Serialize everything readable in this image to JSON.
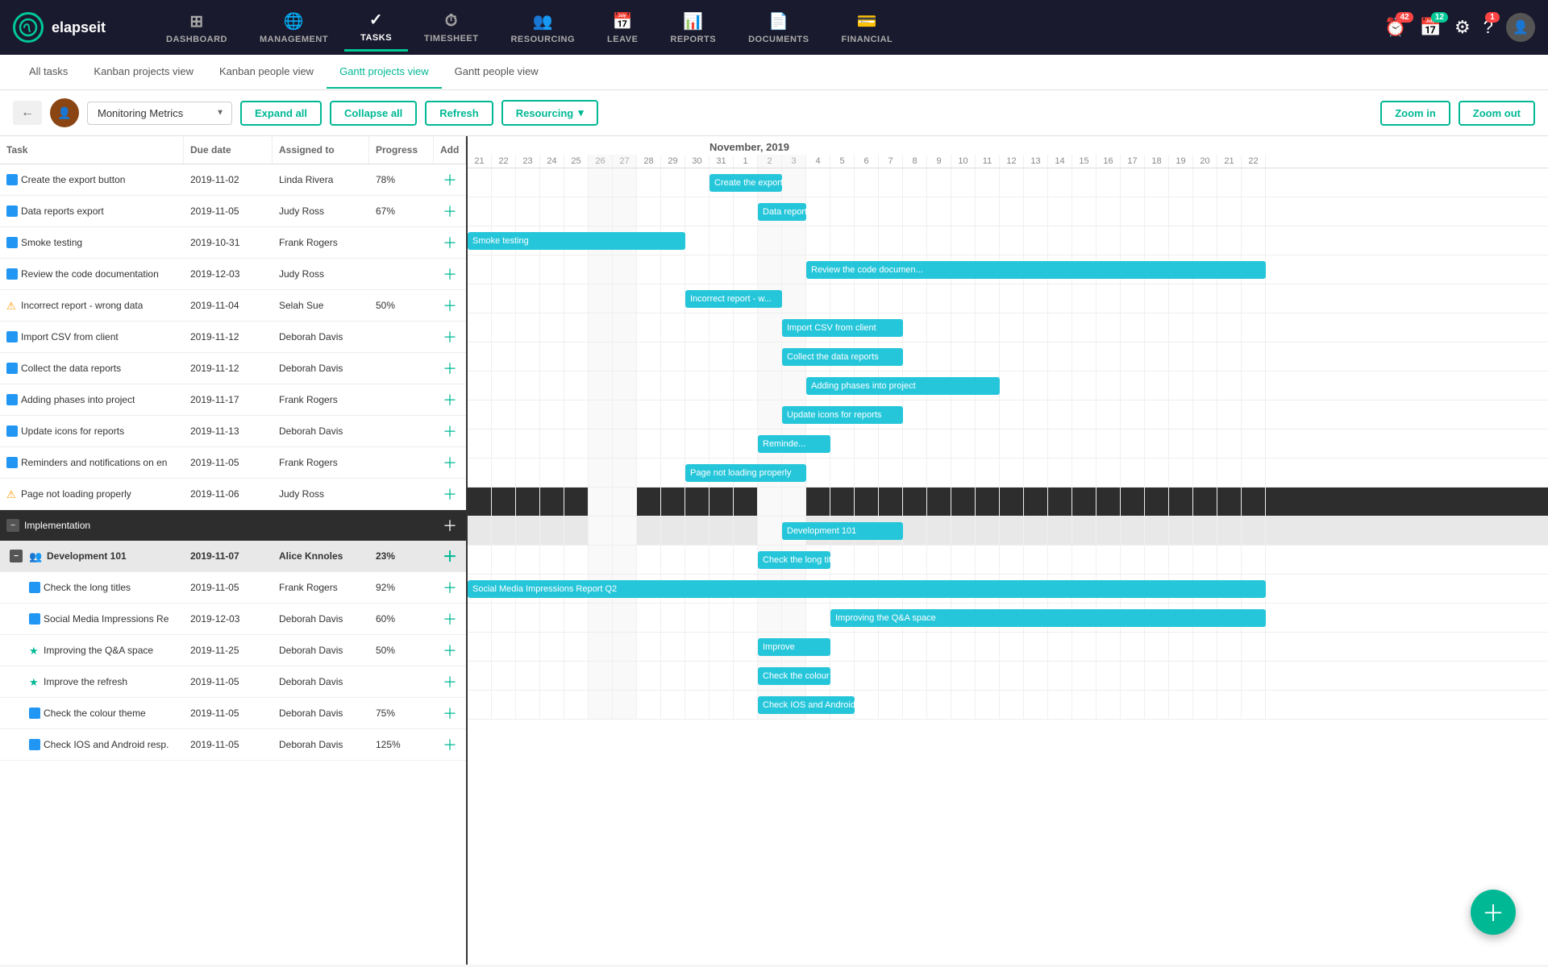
{
  "app": {
    "logo_text": "elapseit",
    "logo_icon": "©"
  },
  "nav": {
    "items": [
      {
        "id": "dashboard",
        "label": "DASHBOARD",
        "icon": "⊞"
      },
      {
        "id": "management",
        "label": "MANAGEMENT",
        "icon": "🌐"
      },
      {
        "id": "tasks",
        "label": "TASKS",
        "icon": "✓",
        "active": true
      },
      {
        "id": "timesheet",
        "label": "TIMESHEET",
        "icon": "⏱"
      },
      {
        "id": "resourcing",
        "label": "RESOURCING",
        "icon": "👥"
      },
      {
        "id": "leave",
        "label": "LEAVE",
        "icon": "📅"
      },
      {
        "id": "reports",
        "label": "REPORTS",
        "icon": "📊"
      },
      {
        "id": "documents",
        "label": "DOCUMENTS",
        "icon": "📄"
      },
      {
        "id": "financial",
        "label": "FINANCIAL",
        "icon": "💳"
      }
    ],
    "badges": {
      "alerts": "42",
      "calendar": "12"
    }
  },
  "sub_nav": {
    "items": [
      {
        "id": "all-tasks",
        "label": "All tasks"
      },
      {
        "id": "kanban-projects",
        "label": "Kanban projects view"
      },
      {
        "id": "kanban-people",
        "label": "Kanban people view"
      },
      {
        "id": "gantt-projects",
        "label": "Gantt projects view",
        "active": true
      },
      {
        "id": "gantt-people",
        "label": "Gantt people view"
      }
    ]
  },
  "toolbar": {
    "project_name": "Monitoring Metrics",
    "expand_label": "Expand all",
    "collapse_label": "Collapse all",
    "refresh_label": "Refresh",
    "resourcing_label": "Resourcing",
    "zoom_in_label": "Zoom in",
    "zoom_out_label": "Zoom out"
  },
  "table": {
    "headers": [
      "Task",
      "Due date",
      "Assigned to",
      "Progress",
      "Add"
    ],
    "tasks": [
      {
        "icon": "blue",
        "name": "Create the export button",
        "date": "2019-11-02",
        "assignee": "Linda Rivera",
        "progress": "78%",
        "indent": 0
      },
      {
        "icon": "blue",
        "name": "Data reports export",
        "date": "2019-11-05",
        "assignee": "Judy Ross",
        "progress": "67%",
        "indent": 0
      },
      {
        "icon": "blue",
        "name": "Smoke testing",
        "date": "2019-10-31",
        "assignee": "Frank Rogers",
        "progress": "",
        "indent": 0
      },
      {
        "icon": "blue",
        "name": "Review the code documentation",
        "date": "2019-12-03",
        "assignee": "Judy Ross",
        "progress": "",
        "indent": 0
      },
      {
        "icon": "warn",
        "name": "Incorrect report - wrong data",
        "date": "2019-11-04",
        "assignee": "Selah Sue",
        "progress": "50%",
        "indent": 0
      },
      {
        "icon": "blue",
        "name": "Import CSV from client",
        "date": "2019-11-12",
        "assignee": "Deborah Davis",
        "progress": "",
        "indent": 0
      },
      {
        "icon": "blue",
        "name": "Collect the data reports",
        "date": "2019-11-12",
        "assignee": "Deborah Davis",
        "progress": "",
        "indent": 0
      },
      {
        "icon": "blue",
        "name": "Adding phases into project",
        "date": "2019-11-17",
        "assignee": "Frank Rogers",
        "progress": "",
        "indent": 0
      },
      {
        "icon": "blue",
        "name": "Update icons for reports",
        "date": "2019-11-13",
        "assignee": "Deborah Davis",
        "progress": "",
        "indent": 0
      },
      {
        "icon": "blue",
        "name": "Reminders and notifications on en",
        "date": "2019-11-05",
        "assignee": "Frank Rogers",
        "progress": "",
        "indent": 0
      },
      {
        "icon": "warn",
        "name": "Page not loading properly",
        "date": "2019-11-06",
        "assignee": "Judy Ross",
        "progress": "",
        "indent": 0
      }
    ],
    "impl_group": {
      "name": "Implementation",
      "subgroup": {
        "name": "Development 101",
        "date": "2019-11-07",
        "assignee": "Alice Knnoles",
        "progress": "23%",
        "tasks": [
          {
            "icon": "blue",
            "name": "Check the long titles",
            "date": "2019-11-05",
            "assignee": "Frank Rogers",
            "progress": "92%"
          },
          {
            "icon": "blue",
            "name": "Social Media Impressions Re",
            "date": "2019-12-03",
            "assignee": "Deborah Davis",
            "progress": "60%"
          },
          {
            "icon": "star",
            "name": "Improving the Q&A space",
            "date": "2019-11-25",
            "assignee": "Deborah Davis",
            "progress": "50%"
          },
          {
            "icon": "star",
            "name": "Improve the refresh",
            "date": "2019-11-05",
            "assignee": "Deborah Davis",
            "progress": ""
          },
          {
            "icon": "blue",
            "name": "Check the colour theme",
            "date": "2019-11-05",
            "assignee": "Deborah Davis",
            "progress": "75%"
          },
          {
            "icon": "blue",
            "name": "Check IOS and Android resp.",
            "date": "2019-11-05",
            "assignee": "Deborah Davis",
            "progress": "125%"
          }
        ]
      }
    }
  },
  "gantt": {
    "month": "November, 2019",
    "days": [
      21,
      22,
      23,
      24,
      25,
      26,
      27,
      28,
      29,
      30,
      31,
      1,
      2,
      3,
      4,
      5,
      6,
      7,
      8,
      9,
      10,
      11,
      12,
      13,
      14,
      15,
      16,
      17,
      18,
      19,
      20,
      21,
      22
    ],
    "bars": [
      {
        "label": "Create the export b...",
        "start": 10,
        "width": 4,
        "row": 0
      },
      {
        "label": "Data reports e...",
        "start": 12,
        "width": 3,
        "row": 1
      },
      {
        "label": "Smoke testing",
        "start": 0,
        "width": 9,
        "row": 2
      },
      {
        "label": "Review the code documen...",
        "start": 14,
        "width": 18,
        "row": 3
      },
      {
        "label": "Incorrect report - w...",
        "start": 9,
        "width": 4,
        "row": 4
      },
      {
        "label": "Import CSV from client",
        "start": 13,
        "width": 5,
        "row": 5
      },
      {
        "label": "Collect the data reports",
        "start": 13,
        "width": 5,
        "row": 6
      },
      {
        "label": "Adding phases into project",
        "start": 14,
        "width": 7,
        "row": 7
      },
      {
        "label": "Update icons for reports",
        "start": 13,
        "width": 5,
        "row": 8
      },
      {
        "label": "Reminde...",
        "start": 12,
        "width": 3,
        "row": 9
      },
      {
        "label": "Page not loading properly",
        "start": 9,
        "width": 5,
        "row": 10
      },
      {
        "label": "Development 101",
        "start": 13,
        "width": 5,
        "row": 12
      },
      {
        "label": "Check the long titles",
        "start": 12,
        "width": 4,
        "row": 13
      },
      {
        "label": "Social Media Impressions Report Q2",
        "start": 0,
        "width": 33,
        "row": 14
      },
      {
        "label": "Improving the Q&A space",
        "start": 14,
        "width": 19,
        "row": 15
      },
      {
        "label": "Improve",
        "start": 12,
        "width": 3,
        "row": 16
      },
      {
        "label": "Check the colour theme",
        "start": 12,
        "width": 4,
        "row": 17
      },
      {
        "label": "Check IOS and Android response",
        "start": 12,
        "width": 4,
        "row": 18
      }
    ]
  }
}
